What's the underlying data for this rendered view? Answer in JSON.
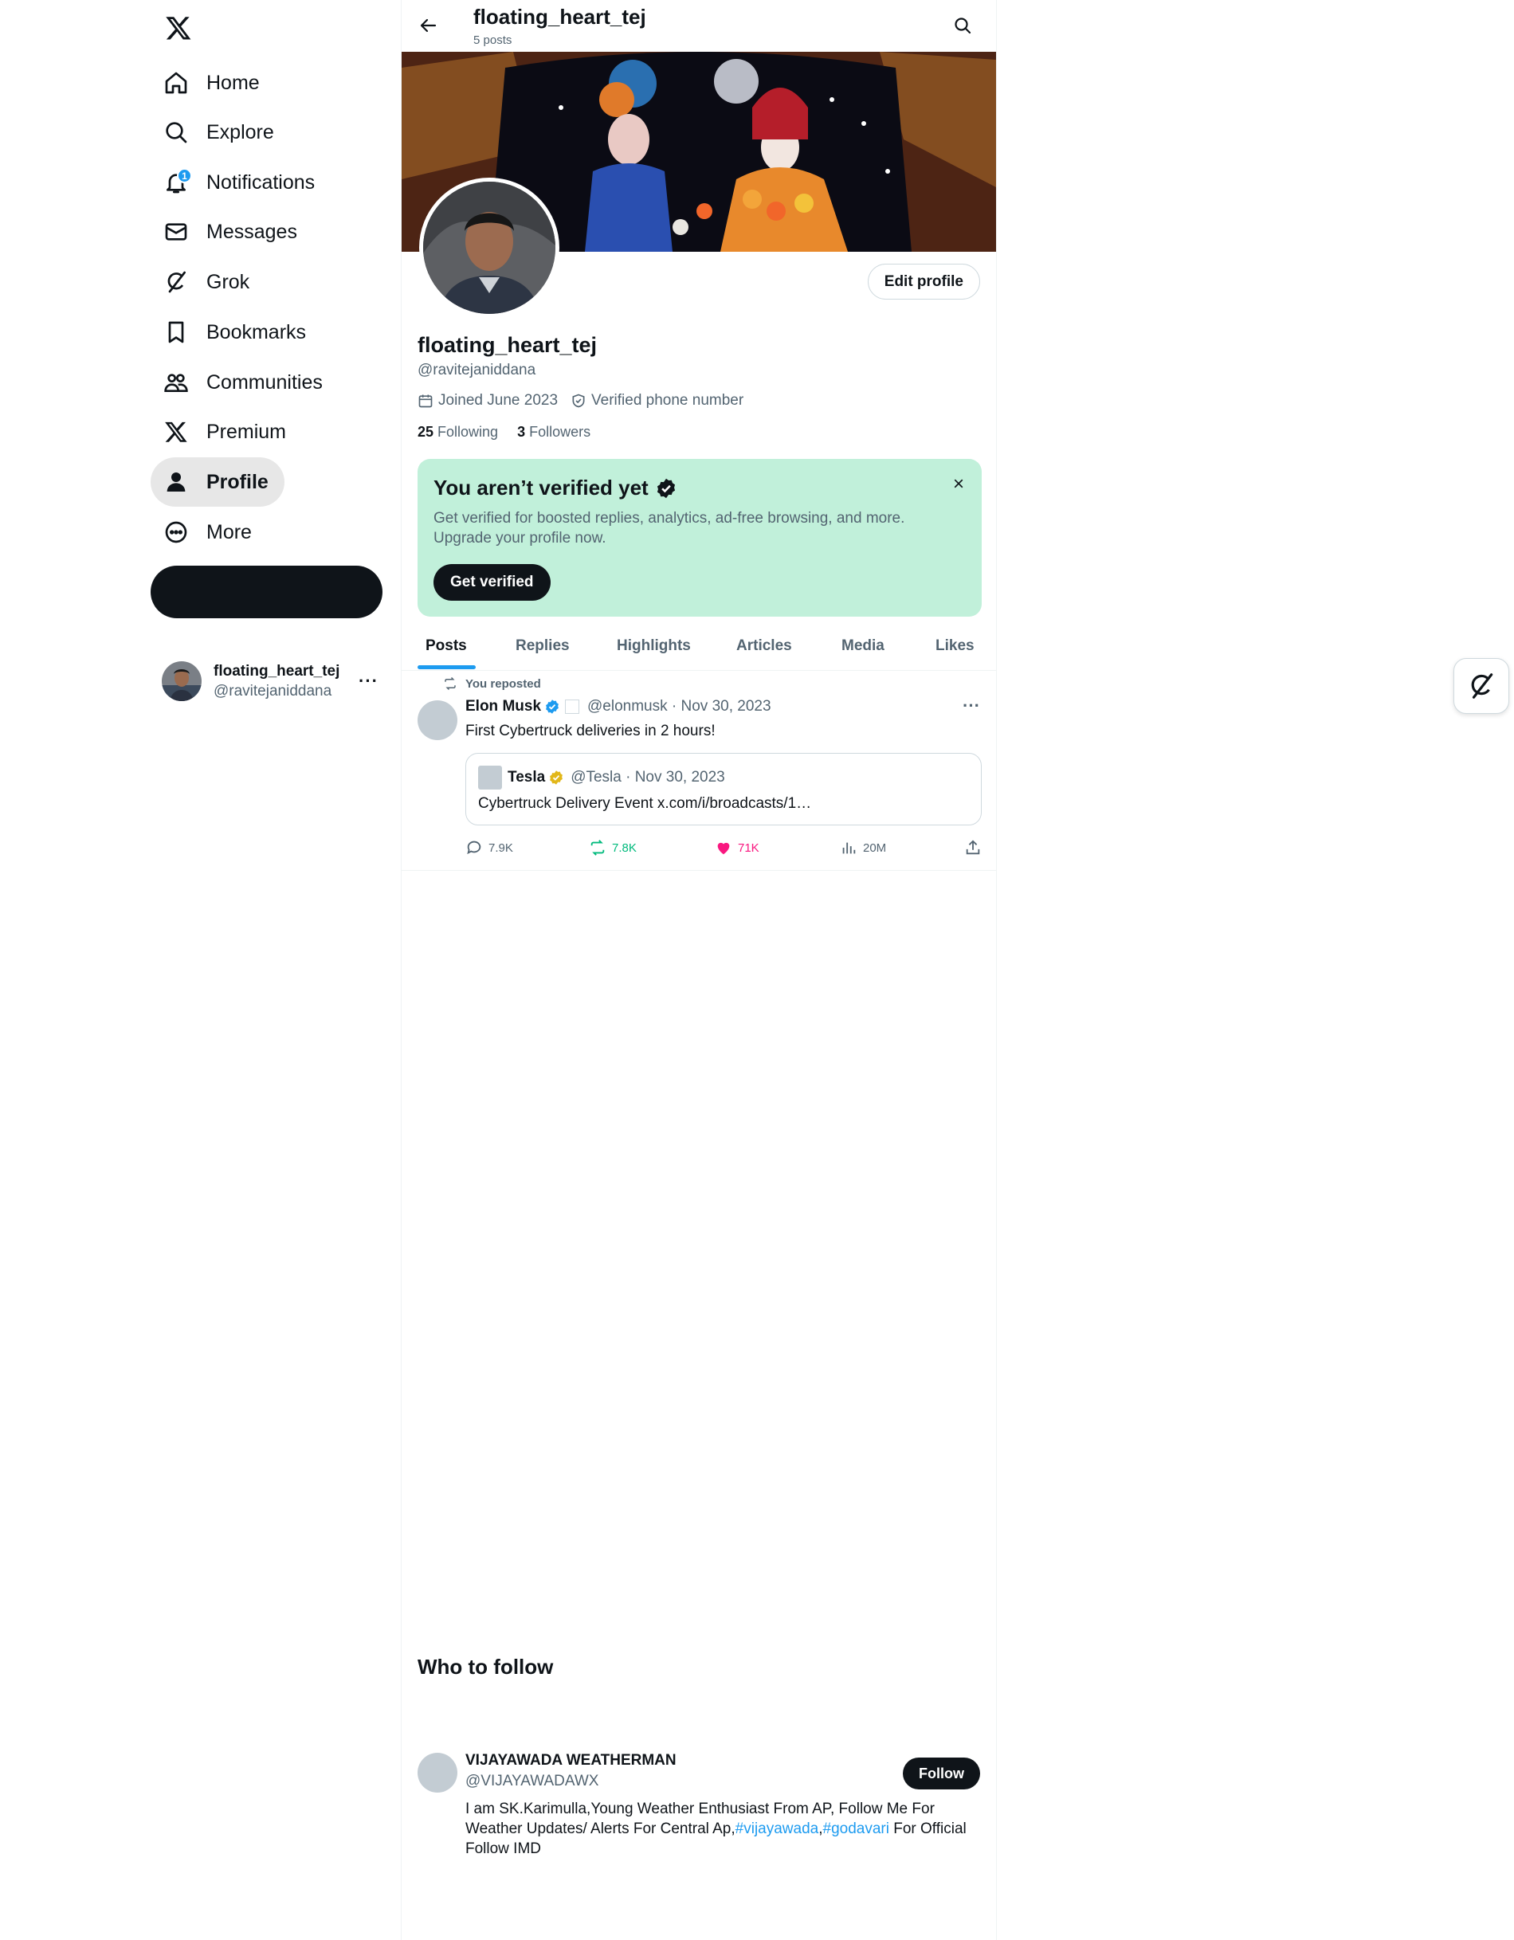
{
  "sidebar": {
    "items": [
      {
        "label": "Home",
        "icon": "home-icon"
      },
      {
        "label": "Explore",
        "icon": "search-icon"
      },
      {
        "label": "Notifications",
        "icon": "bell-icon",
        "badge": "1"
      },
      {
        "label": "Messages",
        "icon": "envelope-icon"
      },
      {
        "label": "Grok",
        "icon": "grok-icon"
      },
      {
        "label": "Bookmarks",
        "icon": "bookmark-icon"
      },
      {
        "label": "Communities",
        "icon": "people-icon"
      },
      {
        "label": "Premium",
        "icon": "x-logo-icon"
      },
      {
        "label": "Profile",
        "icon": "person-icon",
        "active": true
      },
      {
        "label": "More",
        "icon": "more-circle-icon"
      }
    ],
    "account": {
      "name": "floating_heart_tej",
      "handle": "@ravitejaniddana",
      "menu": "···"
    }
  },
  "header": {
    "title": "floating_heart_tej",
    "subtitle": "5 posts"
  },
  "profile": {
    "edit_label": "Edit profile",
    "name": "floating_heart_tej",
    "handle": "@ravitejaniddana",
    "joined": "Joined June 2023",
    "verified_phone": "Verified phone number",
    "following_count": "25",
    "following_label": "Following",
    "followers_count": "3",
    "followers_label": "Followers"
  },
  "verify_card": {
    "title": "You aren’t verified yet",
    "text": "Get verified for boosted replies, analytics, ad-free browsing, and more. Upgrade your profile now.",
    "button": "Get verified",
    "close": "×",
    "background": "#c1f0da"
  },
  "tabs": [
    "Posts",
    "Replies",
    "Highlights",
    "Articles",
    "Media",
    "Likes"
  ],
  "post": {
    "repost_label": "You reposted",
    "author": "Elon Musk",
    "handle_date": "@elonmusk · Nov 30, 2023",
    "text": "First Cybertruck deliveries in 2 hours!",
    "more": "···",
    "quote": {
      "author": "Tesla",
      "handle_date": "@Tesla · Nov 30, 2023",
      "text": "Cybertruck Delivery Event x.com/i/broadcasts/1…"
    },
    "actions": {
      "replies": "7.9K",
      "reposts": "7.8K",
      "likes": "71K",
      "views": "20M"
    }
  },
  "who_to_follow": {
    "title": "Who to follow",
    "user": {
      "name": "VIJAYAWADA WEATHERMAN",
      "handle": "@VIJAYAWADAWX",
      "button": "Follow",
      "bio_part1": "  I am SK.Karimulla,Young Weather Enthusiast From AP, Follow Me For Weather Updates/ Alerts For Central Ap,",
      "tag1": "#vijayawada",
      "comma": ",",
      "tag2": "#godavari",
      "bio_part2": " For Official Follow IMD"
    }
  },
  "colors": {
    "accent": "#1d9bf0",
    "repost": "#00ba7c",
    "like": "#f91880",
    "gold": "#e2b719"
  }
}
